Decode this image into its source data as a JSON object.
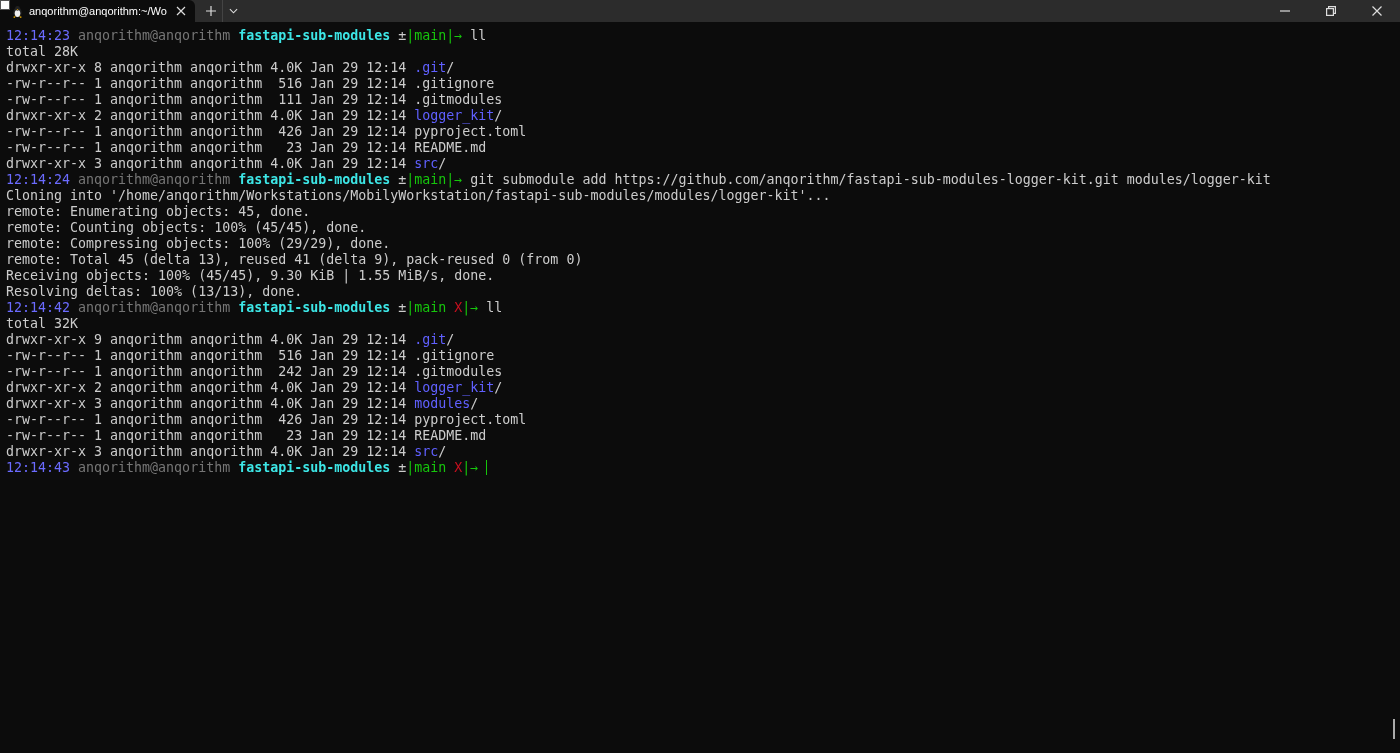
{
  "tab": {
    "title": "anqorithm@anqorithm:~/Wo",
    "selected": true
  },
  "lines": [
    {
      "segments": [
        {
          "kind": "time",
          "text": "12:14:23"
        },
        {
          "kind": "user",
          "text": " anqorithm@anqorithm"
        },
        {
          "kind": "dir",
          "text": " fastapi-sub-modules"
        },
        {
          "kind": "vcs",
          "text": " ±"
        },
        {
          "kind": "branch",
          "text": "|main"
        },
        {
          "kind": "arrow",
          "text": "|→"
        },
        {
          "kind": "cmd",
          "text": " ll"
        }
      ]
    },
    {
      "segments": [
        {
          "kind": "out",
          "text": "total 28K"
        }
      ]
    },
    {
      "segments": [
        {
          "kind": "out",
          "text": "drwxr-xr-x 8 anqorithm anqorithm 4.0K Jan 29 12:14"
        },
        {
          "kind": "folder",
          "text": " .git"
        },
        {
          "kind": "out",
          "text": "/"
        }
      ]
    },
    {
      "segments": [
        {
          "kind": "out",
          "text": "-rw-r--r-- 1 anqorithm anqorithm  516 Jan 29 12:14 .gitignore"
        }
      ]
    },
    {
      "segments": [
        {
          "kind": "out",
          "text": "-rw-r--r-- 1 anqorithm anqorithm  111 Jan 29 12:14 .gitmodules"
        }
      ]
    },
    {
      "segments": [
        {
          "kind": "out",
          "text": "drwxr-xr-x 2 anqorithm anqorithm 4.0K Jan 29 12:14"
        },
        {
          "kind": "folder",
          "text": " logger_kit"
        },
        {
          "kind": "out",
          "text": "/"
        }
      ]
    },
    {
      "segments": [
        {
          "kind": "out",
          "text": "-rw-r--r-- 1 anqorithm anqorithm  426 Jan 29 12:14 pyproject.toml"
        }
      ]
    },
    {
      "segments": [
        {
          "kind": "out",
          "text": "-rw-r--r-- 1 anqorithm anqorithm   23 Jan 29 12:14 README.md"
        }
      ]
    },
    {
      "segments": [
        {
          "kind": "out",
          "text": "drwxr-xr-x 3 anqorithm anqorithm 4.0K Jan 29 12:14"
        },
        {
          "kind": "folder",
          "text": " src"
        },
        {
          "kind": "out",
          "text": "/"
        }
      ]
    },
    {
      "segments": [
        {
          "kind": "time",
          "text": "12:14:24"
        },
        {
          "kind": "user",
          "text": " anqorithm@anqorithm"
        },
        {
          "kind": "dir",
          "text": " fastapi-sub-modules"
        },
        {
          "kind": "vcs",
          "text": " ±"
        },
        {
          "kind": "branch",
          "text": "|main"
        },
        {
          "kind": "arrow",
          "text": "|→"
        },
        {
          "kind": "cmd",
          "text": " git submodule add https://github.com/anqorithm/fastapi-sub-modules-logger-kit.git modules/logger-kit"
        }
      ]
    },
    {
      "segments": [
        {
          "kind": "out",
          "text": "Cloning into '/home/anqorithm/Workstations/MobilyWorkstation/fastapi-sub-modules/modules/logger-kit'..."
        }
      ]
    },
    {
      "segments": [
        {
          "kind": "out",
          "text": "remote: Enumerating objects: 45, done."
        }
      ]
    },
    {
      "segments": [
        {
          "kind": "out",
          "text": "remote: Counting objects: 100% (45/45), done."
        }
      ]
    },
    {
      "segments": [
        {
          "kind": "out",
          "text": "remote: Compressing objects: 100% (29/29), done."
        }
      ]
    },
    {
      "segments": [
        {
          "kind": "out",
          "text": "remote: Total 45 (delta 13), reused 41 (delta 9), pack-reused 0 (from 0)"
        }
      ]
    },
    {
      "segments": [
        {
          "kind": "out",
          "text": "Receiving objects: 100% (45/45), 9.30 KiB | 1.55 MiB/s, done."
        }
      ]
    },
    {
      "segments": [
        {
          "kind": "out",
          "text": "Resolving deltas: 100% (13/13), done."
        }
      ]
    },
    {
      "segments": [
        {
          "kind": "time",
          "text": "12:14:42"
        },
        {
          "kind": "user",
          "text": " anqorithm@anqorithm"
        },
        {
          "kind": "dir",
          "text": " fastapi-sub-modules"
        },
        {
          "kind": "vcs",
          "text": " ±"
        },
        {
          "kind": "branch",
          "text": "|main"
        },
        {
          "kind": "dirty",
          "text": " X"
        },
        {
          "kind": "arrow",
          "text": "|→"
        },
        {
          "kind": "cmd",
          "text": " ll"
        }
      ]
    },
    {
      "segments": [
        {
          "kind": "out",
          "text": "total 32K"
        }
      ]
    },
    {
      "segments": [
        {
          "kind": "out",
          "text": "drwxr-xr-x 9 anqorithm anqorithm 4.0K Jan 29 12:14"
        },
        {
          "kind": "folder",
          "text": " .git"
        },
        {
          "kind": "out",
          "text": "/"
        }
      ]
    },
    {
      "segments": [
        {
          "kind": "out",
          "text": "-rw-r--r-- 1 anqorithm anqorithm  516 Jan 29 12:14 .gitignore"
        }
      ]
    },
    {
      "segments": [
        {
          "kind": "out",
          "text": "-rw-r--r-- 1 anqorithm anqorithm  242 Jan 29 12:14 .gitmodules"
        }
      ]
    },
    {
      "segments": [
        {
          "kind": "out",
          "text": "drwxr-xr-x 2 anqorithm anqorithm 4.0K Jan 29 12:14"
        },
        {
          "kind": "folder",
          "text": " logger_kit"
        },
        {
          "kind": "out",
          "text": "/"
        }
      ]
    },
    {
      "segments": [
        {
          "kind": "out",
          "text": "drwxr-xr-x 3 anqorithm anqorithm 4.0K Jan 29 12:14"
        },
        {
          "kind": "folder",
          "text": " modules"
        },
        {
          "kind": "out",
          "text": "/"
        }
      ]
    },
    {
      "segments": [
        {
          "kind": "out",
          "text": "-rw-r--r-- 1 anqorithm anqorithm  426 Jan 29 12:14 pyproject.toml"
        }
      ]
    },
    {
      "segments": [
        {
          "kind": "out",
          "text": "-rw-r--r-- 1 anqorithm anqorithm   23 Jan 29 12:14 README.md"
        }
      ]
    },
    {
      "segments": [
        {
          "kind": "out",
          "text": "drwxr-xr-x 3 anqorithm anqorithm 4.0K Jan 29 12:14"
        },
        {
          "kind": "folder",
          "text": " src"
        },
        {
          "kind": "out",
          "text": "/"
        }
      ]
    },
    {
      "segments": [
        {
          "kind": "time",
          "text": "12:14:43"
        },
        {
          "kind": "user",
          "text": " anqorithm@anqorithm"
        },
        {
          "kind": "dir",
          "text": " fastapi-sub-modules"
        },
        {
          "kind": "vcs",
          "text": " ±"
        },
        {
          "kind": "branch",
          "text": "|main"
        },
        {
          "kind": "dirty",
          "text": " X"
        },
        {
          "kind": "arrow",
          "text": "|→"
        },
        {
          "kind": "cursor"
        }
      ]
    }
  ]
}
